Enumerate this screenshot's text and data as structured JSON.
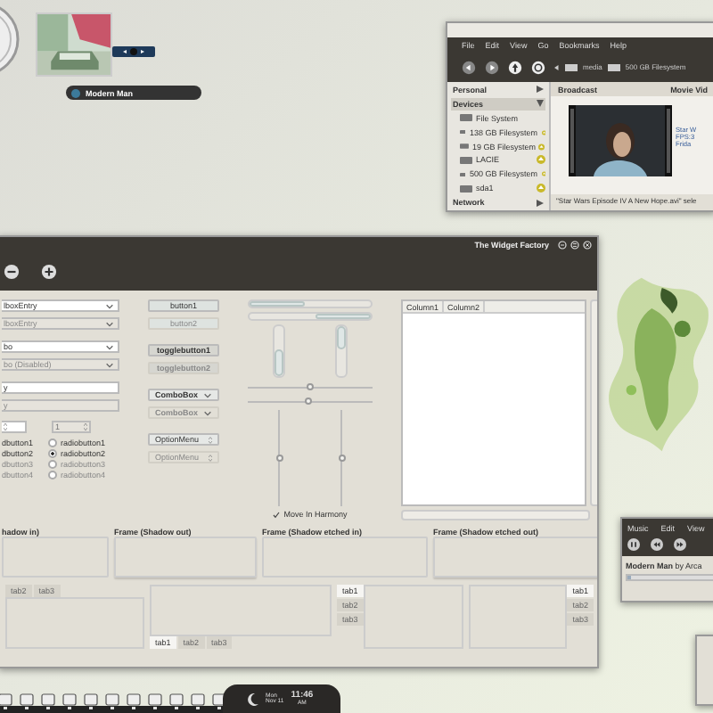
{
  "now_playing": {
    "title": "Modern Man"
  },
  "file_manager": {
    "menu": [
      "File",
      "Edit",
      "View",
      "Go",
      "Bookmarks",
      "Help"
    ],
    "path": [
      "media",
      "500 GB Filesystem"
    ],
    "sidebar": [
      {
        "label": "Personal",
        "expanded": false
      },
      {
        "label": "Devices",
        "expanded": true,
        "children": [
          {
            "label": "File System",
            "ejectable": false
          },
          {
            "label": "138 GB Filesystem",
            "ejectable": true
          },
          {
            "label": "19 GB Filesystem",
            "ejectable": true
          },
          {
            "label": "LACIE",
            "ejectable": true
          },
          {
            "label": "500 GB Filesystem",
            "ejectable": true
          },
          {
            "label": "sda1",
            "ejectable": true
          }
        ]
      },
      {
        "label": "Network",
        "expanded": false
      }
    ],
    "panes": [
      "Broadcast",
      "Movie Vid"
    ],
    "info_lines": [
      "Star W",
      "FPS:3",
      "Frida"
    ],
    "status": "\"Star Wars Episode IV A New Hope.avi\" sele"
  },
  "widget_factory": {
    "title": "The Widget Factory",
    "entries": [
      {
        "kind": "combo_entry",
        "value": "lboxEntry",
        "disabled": false
      },
      {
        "kind": "combo_entry",
        "value": "lboxEntry",
        "disabled": true
      },
      {
        "kind": "combo",
        "value": "bo",
        "disabled": false
      },
      {
        "kind": "combo",
        "value": "bo (Disabled)",
        "disabled": true
      },
      {
        "kind": "entry",
        "value": "y",
        "disabled": false
      },
      {
        "kind": "entry",
        "value": "y",
        "disabled": true
      }
    ],
    "spin_buttons": [
      {
        "disabled": false
      },
      {
        "value": "1",
        "disabled": true
      }
    ],
    "check_buttons": [
      {
        "label": "dbutton1",
        "disabled": false
      },
      {
        "label": "dbutton2",
        "disabled": false
      },
      {
        "label": "dbutton3",
        "disabled": true
      },
      {
        "label": "dbutton4",
        "disabled": true
      }
    ],
    "radio_buttons": [
      {
        "label": "radiobutton1",
        "selected": false,
        "disabled": false
      },
      {
        "label": "radiobutton2",
        "selected": true,
        "disabled": false
      },
      {
        "label": "radiobutton3",
        "selected": false,
        "disabled": true
      },
      {
        "label": "radiobutton4",
        "selected": false,
        "disabled": true
      }
    ],
    "buttons": [
      {
        "kind": "button",
        "label": "button1",
        "disabled": false
      },
      {
        "kind": "button",
        "label": "button2",
        "disabled": true
      },
      {
        "kind": "toggle",
        "label": "togglebutton1",
        "disabled": false
      },
      {
        "kind": "toggle",
        "label": "togglebutton2",
        "disabled": true
      },
      {
        "kind": "combo",
        "label": "ComboBox",
        "disabled": false
      },
      {
        "kind": "combo",
        "label": "ComboBox",
        "disabled": true
      },
      {
        "kind": "option",
        "label": "OptionMenu",
        "disabled": false
      },
      {
        "kind": "option",
        "label": "OptionMenu",
        "disabled": true
      }
    ],
    "progress_h": [
      {
        "level": 0.45,
        "inverted": false
      },
      {
        "level": 0.45,
        "inverted": true
      }
    ],
    "progress_v": [
      {
        "level": 0.55,
        "inverted": false
      },
      {
        "level": 0.45,
        "inverted": true
      }
    ],
    "scales_h": [
      {
        "level": 0.5
      },
      {
        "level": 0.48
      }
    ],
    "scales_v": [
      {
        "level": 0.5
      },
      {
        "level": 0.5
      }
    ],
    "harmony": {
      "label": "Move In Harmony",
      "checked": true
    },
    "tree": {
      "columns": [
        "Column1",
        "Column2"
      ]
    },
    "frames": [
      "hadow in)",
      "Frame (Shadow out)",
      "Frame (Shadow etched in)",
      "Frame (Shadow etched out)"
    ],
    "notebooks": [
      {
        "kind": "top",
        "tabs": [
          {
            "label": "tab2",
            "selected": false
          },
          {
            "label": "tab3",
            "selected": false
          }
        ]
      },
      {
        "kind": "bottom",
        "tabs": [
          {
            "label": "tab1",
            "selected": true
          },
          {
            "label": "tab2",
            "selected": false
          },
          {
            "label": "tab3",
            "selected": false
          }
        ]
      },
      {
        "kind": "left",
        "tabs": [
          {
            "label": "tab1",
            "selected": true
          },
          {
            "label": "tab2",
            "selected": false
          },
          {
            "label": "tab3",
            "selected": false
          }
        ]
      },
      {
        "kind": "right",
        "tabs": [
          {
            "label": "tab1",
            "selected": true
          },
          {
            "label": "tab2",
            "selected": false
          },
          {
            "label": "tab3",
            "selected": false
          }
        ]
      }
    ]
  },
  "music_player": {
    "menu": [
      "Music",
      "Edit",
      "View"
    ],
    "track": "Modern Man",
    "artist": "by Arca",
    "level": 0.05
  },
  "panel": {
    "day": "Mon",
    "date": "Nov 11",
    "time": "11:46",
    "period": "AM"
  }
}
